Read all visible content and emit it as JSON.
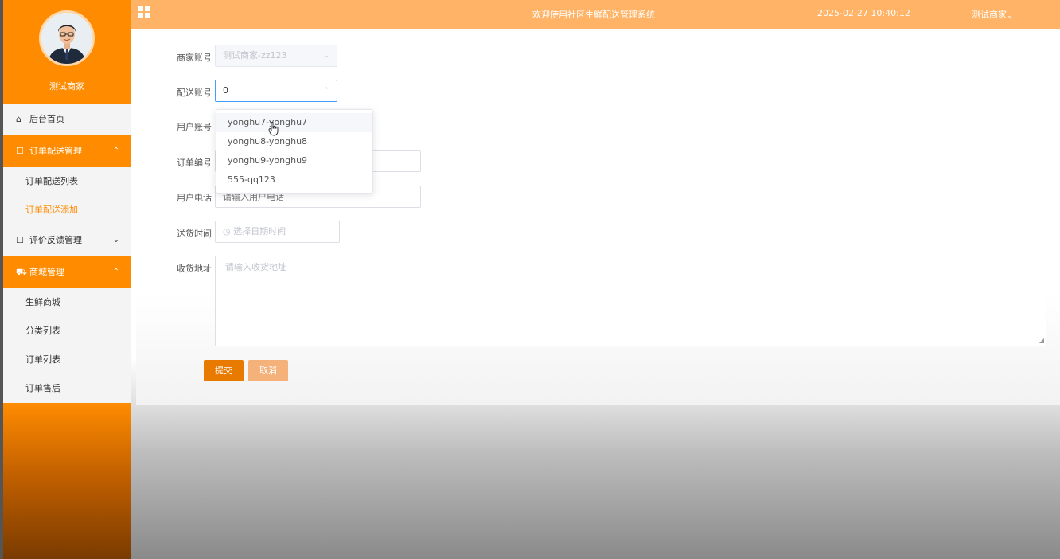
{
  "user": {
    "name": "测试商家"
  },
  "sidebar": {
    "items": [
      {
        "label": "后台首页",
        "icon": "home-icon"
      },
      {
        "label": "订单配送管理",
        "icon": "edit-icon",
        "expanded": true,
        "children": [
          "订单配送列表",
          "订单配送添加"
        ]
      },
      {
        "label": "评价反馈管理",
        "icon": "edit-icon",
        "expanded": false
      },
      {
        "label": "商城管理",
        "icon": "cart-icon",
        "expanded": true,
        "children": [
          "生鲜商城",
          "分类列表",
          "订单列表",
          "订单售后"
        ]
      }
    ],
    "active_child": "订单配送添加"
  },
  "header": {
    "title": "欢迎使用社区生鲜配送管理系统",
    "datetime": "2025-02-27 10:40:12",
    "user_menu": "测试商家"
  },
  "form": {
    "merchant_account": {
      "label": "商家账号",
      "value": "测试商家-zz123"
    },
    "delivery_account": {
      "label": "配送账号",
      "value": "0"
    },
    "user_account": {
      "label": "用户账号"
    },
    "order_no": {
      "label": "订单编号"
    },
    "user_phone": {
      "label": "用户电话",
      "placeholder": "请输入用户电话"
    },
    "delivery_time": {
      "label": "送货时间",
      "placeholder": "选择日期时间"
    },
    "address": {
      "label": "收货地址",
      "placeholder": "请输入收货地址"
    },
    "submit": "提交",
    "cancel": "取消"
  },
  "dropdown": {
    "options": [
      "yonghu7-yonghu7",
      "yonghu8-yonghu8",
      "yonghu9-yonghu9",
      "555-qq123"
    ],
    "hovered_index": 0
  },
  "colors": {
    "accent": "#ff8c00",
    "header": "#ffb366",
    "focus": "#409eff"
  }
}
